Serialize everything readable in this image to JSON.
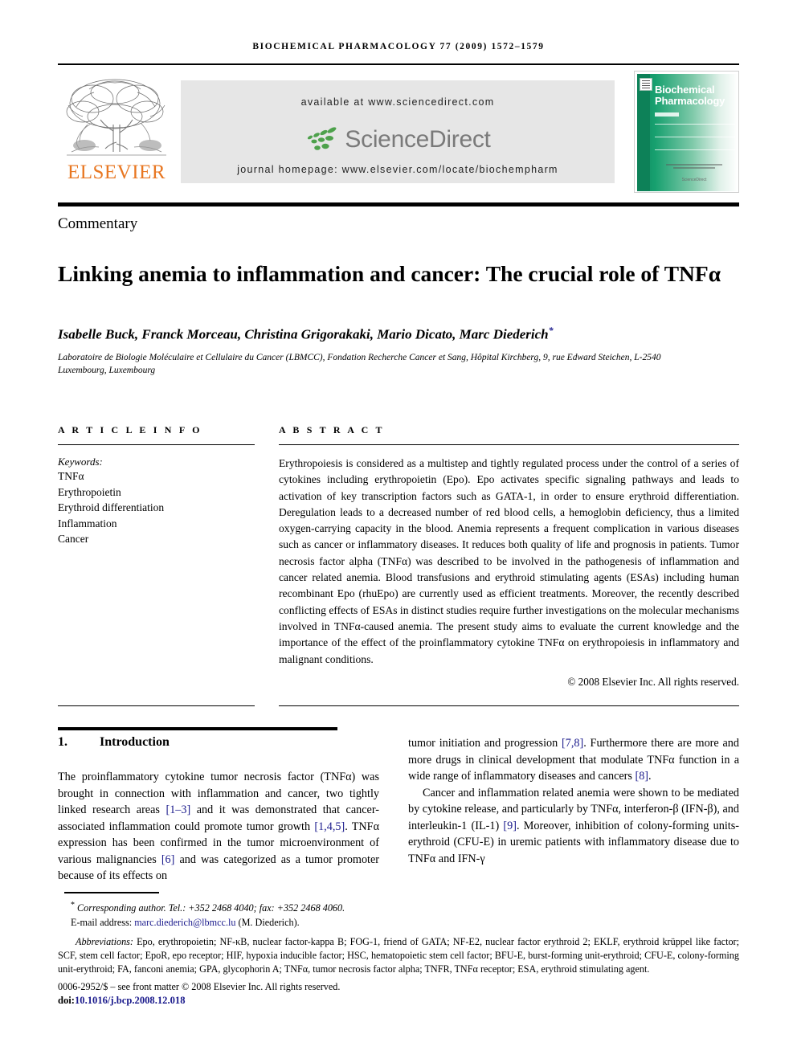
{
  "running_head": "BIOCHEMICAL PHARMACOLOGY 77 (2009) 1572–1579",
  "header": {
    "elsevier_wordmark": "ELSEVIER",
    "available_at": "available at www.sciencedirect.com",
    "sciencedirect_wordmark": "ScienceDirect",
    "journal_homepage": "journal homepage: www.elsevier.com/locate/biochempharm",
    "cover_title_line1": "Biochemical",
    "cover_title_line2": "Pharmacology",
    "cover_footer_brand": "ScienceDirect",
    "colors": {
      "elsevier_orange": "#E87722",
      "banner_gray": "#e6e6e6",
      "sciencedirect_green": "#4DA14B",
      "sciencedirect_text_gray": "#7a7a7a",
      "cover_green": "#0d8158",
      "link_blue": "#1a1a8c"
    }
  },
  "article": {
    "type": "Commentary",
    "title": "Linking anemia to inflammation and cancer: The crucial role of TNFα",
    "authors": "Isabelle Buck, Franck Morceau, Christina Grigorakaki, Mario Dicato, Marc Diederich",
    "corresponding_marker": "*",
    "affiliation": "Laboratoire de Biologie Moléculaire et Cellulaire du Cancer (LBMCC), Fondation Recherche Cancer et Sang, Hôpital Kirchberg, 9, rue Edward Steichen, L-2540 Luxembourg, Luxembourg"
  },
  "article_info": {
    "heading": "A R T I C L E   I N F O",
    "keywords_label": "Keywords:",
    "keywords": [
      "TNFα",
      "Erythropoietin",
      "Erythroid differentiation",
      "Inflammation",
      "Cancer"
    ]
  },
  "abstract": {
    "heading": "A B S T R A C T",
    "text": "Erythropoiesis is considered as a multistep and tightly regulated process under the control of a series of cytokines including erythropoietin (Epo). Epo activates specific signaling pathways and leads to activation of key transcription factors such as GATA-1, in order to ensure erythroid differentiation. Deregulation leads to a decreased number of red blood cells, a hemoglobin deficiency, thus a limited oxygen-carrying capacity in the blood. Anemia represents a frequent complication in various diseases such as cancer or inflammatory diseases. It reduces both quality of life and prognosis in patients. Tumor necrosis factor alpha (TNFα) was described to be involved in the pathogenesis of inflammation and cancer related anemia. Blood transfusions and erythroid stimulating agents (ESAs) including human recombinant Epo (rhuEpo) are currently used as efficient treatments. Moreover, the recently described conflicting effects of ESAs in distinct studies require further investigations on the molecular mechanisms involved in TNFα-caused anemia. The present study aims to evaluate the current knowledge and the importance of the effect of the proinflammatory cytokine TNFα on erythropoiesis in inflammatory and malignant conditions.",
    "copyright": "© 2008 Elsevier Inc. All rights reserved."
  },
  "body": {
    "section_number": "1.",
    "section_title": "Introduction",
    "left_paragraph_parts": [
      "The proinflammatory cytokine tumor necrosis factor (TNFα) was brought in connection with inflammation and cancer, two tightly linked research areas ",
      "[1–3]",
      " and it was demonstrated that cancer-associated inflammation could promote tumor growth ",
      "[1,4,5]",
      ". TNFα expression has been confirmed in the tumor microenvironment of various malignancies ",
      "[6]",
      " and was categorized as a tumor promoter because of its effects on"
    ],
    "right_paragraph1_parts": [
      "tumor initiation and progression ",
      "[7,8]",
      ". Furthermore there are more and more drugs in clinical development that modulate TNFα function in a wide range of inflammatory diseases and cancers ",
      "[8]",
      "."
    ],
    "right_paragraph2_parts": [
      "Cancer and inflammation related anemia were shown to be mediated by cytokine release, and particularly by TNFα, interferon-β (IFN-β), and interleukin-1 (IL-1) ",
      "[9]",
      ". Moreover, inhibition of colony-forming units-erythroid (CFU-E) in uremic patients with inflammatory disease due to TNFα and IFN-γ"
    ]
  },
  "footnotes": {
    "corresponding_star": "*",
    "corresponding_text": "Corresponding author. Tel.: +352 2468 4040; fax: +352 2468 4060.",
    "email_label": "E-mail address:",
    "email": "marc.diederich@lbmcc.lu",
    "email_owner": "(M. Diederich).",
    "abbreviations_label": "Abbreviations:",
    "abbreviations_text": "Epo, erythropoietin; NF-κB, nuclear factor-kappa B; FOG-1, friend of GATA; NF-E2, nuclear factor erythroid 2; EKLF, erythroid krüppel like factor; SCF, stem cell factor; EpoR, epo receptor; HIF, hypoxia inducible factor; HSC, hematopoietic stem cell factor; BFU-E, burst-forming unit-erythroid; CFU-E, colony-forming unit-erythroid; FA, fanconi anemia; GPA, glycophorin A; TNFα, tumor necrosis factor alpha; TNFR, TNFα receptor; ESA, erythroid stimulating agent.",
    "front_matter": "0006-2952/$ – see front matter © 2008 Elsevier Inc. All rights reserved.",
    "doi_label": "doi:",
    "doi_value": "10.1016/j.bcp.2008.12.018"
  }
}
